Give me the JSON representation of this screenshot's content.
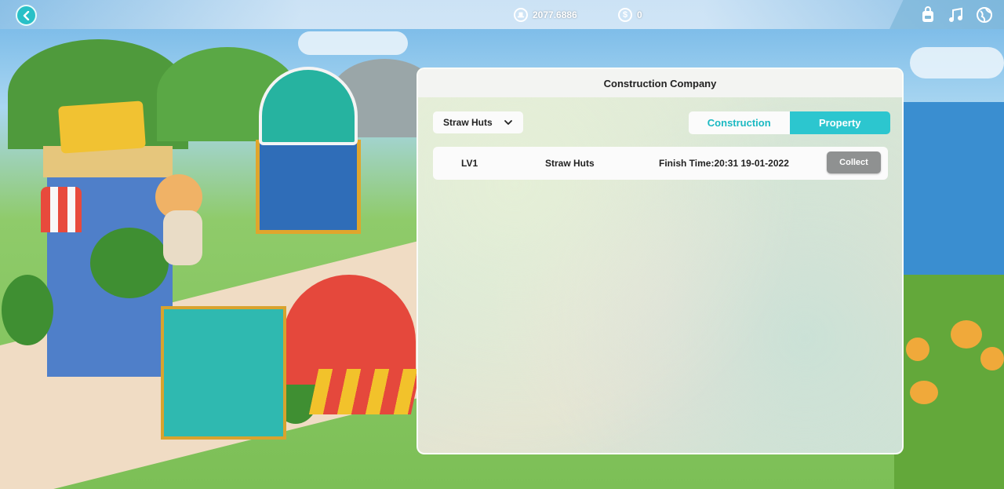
{
  "topbar": {
    "currency_primary": "2077.6886",
    "currency_secondary": "0",
    "currency_secondary_symbol": "$"
  },
  "panel": {
    "title": "Construction Company",
    "dropdown": {
      "selected": "Straw Huts"
    },
    "tabs": [
      {
        "label": "Construction",
        "active": false
      },
      {
        "label": "Property",
        "active": true
      }
    ],
    "rows": [
      {
        "level": "LV1",
        "name": "Straw Huts",
        "finish_time": "Finish Time:20:31 19-01-2022",
        "action": "Collect"
      }
    ]
  },
  "colors": {
    "accent": "#2cc6cf",
    "button_disabled": "#8f9191"
  },
  "icons": [
    "back-arrow-icon",
    "top-hat-icon",
    "dollar-coin-icon",
    "backpack-icon",
    "music-note-icon",
    "globe-icon",
    "chevron-down-icon"
  ]
}
